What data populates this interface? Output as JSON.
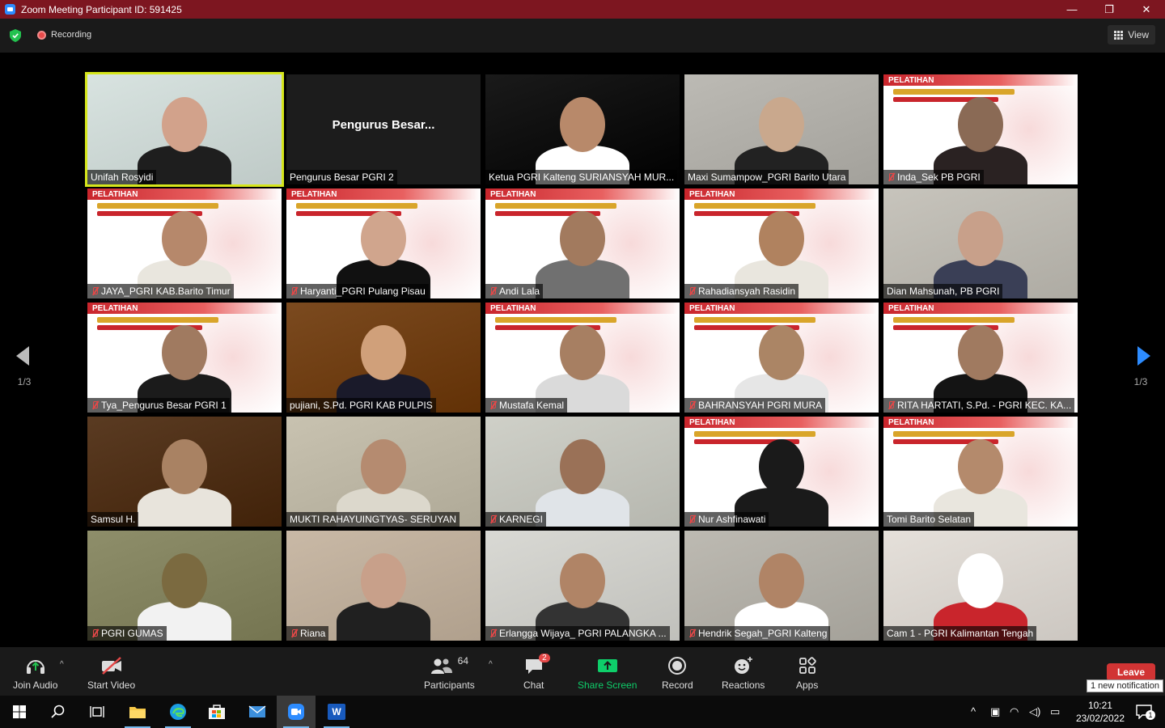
{
  "titlebar": {
    "title": "Zoom Meeting Participant ID: 591425",
    "minimize": "—",
    "maximize": "❐",
    "close": "✕"
  },
  "topbar": {
    "recording": "Recording",
    "view": "View"
  },
  "participants": [
    {
      "name": "Unifah Rosyidi",
      "muted": false,
      "style": "video",
      "colors": [
        "#d8e3e0",
        "#1e1e1e",
        "#d2a28b"
      ]
    },
    {
      "name": "Pengurus Besar PGRI 2",
      "muted": false,
      "style": "name",
      "display": "Pengurus  Besar..."
    },
    {
      "name": "Ketua PGRI Kalteng SURIANSYAH MUR...",
      "muted": false,
      "style": "video",
      "colors": [
        "#1a1a1a",
        "#ffffff",
        "#b8896a"
      ]
    },
    {
      "name": "Maxi Sumampow_PGRI Barito Utara",
      "muted": false,
      "style": "video",
      "colors": [
        "#bcbab4",
        "#222222",
        "#c9a88d"
      ]
    },
    {
      "name": "Inda_Sek PB PGRI",
      "muted": true,
      "style": "banner",
      "colors": [
        "#ffffff",
        "#2a2222",
        "#8a6a55"
      ]
    },
    {
      "name": "JAYA_PGRI KAB.Barito Timur",
      "muted": true,
      "style": "banner",
      "colors": [
        "#ffffff",
        "#e9e6de",
        "#b6886b"
      ]
    },
    {
      "name": "Haryanti_PGRI Pulang Pisau",
      "muted": true,
      "style": "banner",
      "colors": [
        "#ffffff",
        "#111111",
        "#d0a58d"
      ]
    },
    {
      "name": "Andi Lala",
      "muted": true,
      "style": "banner",
      "colors": [
        "#ffffff",
        "#707070",
        "#a27a5e"
      ]
    },
    {
      "name": "Rahadiansyah Rasidin",
      "muted": true,
      "style": "banner",
      "colors": [
        "#ffffff",
        "#e9e6de",
        "#b0825f"
      ]
    },
    {
      "name": "Dian Mahsunah, PB PGRI",
      "muted": false,
      "style": "video",
      "colors": [
        "#c7c4bc",
        "#3a3f56",
        "#c8a08a"
      ]
    },
    {
      "name": "Tya_Pengurus Besar PGRI 1",
      "muted": true,
      "style": "banner",
      "colors": [
        "#ffffff",
        "#1b1b1b",
        "#a07a60"
      ]
    },
    {
      "name": "pujiani, S.Pd. PGRI KAB PULPIS",
      "muted": false,
      "style": "video",
      "colors": [
        "#7b4a1f",
        "#1a1a2a",
        "#d0a07a"
      ]
    },
    {
      "name": "Mustafa Kemal",
      "muted": true,
      "style": "banner",
      "colors": [
        "#ffffff",
        "#dadada",
        "#a77f62"
      ]
    },
    {
      "name": "BAHRANSYAH PGRI MURA",
      "muted": true,
      "style": "banner",
      "colors": [
        "#ffffff",
        "#e6e6e6",
        "#ab8565"
      ]
    },
    {
      "name": "RITA HARTATI, S.Pd. - PGRI KEC. KA...",
      "muted": true,
      "style": "banner",
      "colors": [
        "#ffffff",
        "#141414",
        "#a07a60"
      ]
    },
    {
      "name": "Samsul H.",
      "muted": false,
      "style": "video",
      "colors": [
        "#5a3b22",
        "#e8e4dc",
        "#a98263"
      ]
    },
    {
      "name": "MUKTI RAHAYUINGTYAS- SERUYAN",
      "muted": false,
      "style": "video",
      "colors": [
        "#c8c2b0",
        "#dcd8cc",
        "#b58b70"
      ]
    },
    {
      "name": "KARNEGI",
      "muted": true,
      "style": "video",
      "colors": [
        "#cfd0c8",
        "#e0e4e8",
        "#9a7157"
      ]
    },
    {
      "name": "Nur Ashfinawati",
      "muted": true,
      "style": "banner",
      "colors": [
        "#ffffff",
        "#1a1a1a",
        "#1a1a1a"
      ]
    },
    {
      "name": "Tomi Barito Selatan",
      "muted": false,
      "style": "banner",
      "colors": [
        "#ffffff",
        "#e9e6de",
        "#b48a6c"
      ]
    },
    {
      "name": "PGRI GUMAS",
      "muted": true,
      "style": "video",
      "colors": [
        "#8e8e6a",
        "#f2f2f2",
        "#7b6a40"
      ]
    },
    {
      "name": "Riana",
      "muted": true,
      "style": "video",
      "colors": [
        "#c9b9a6",
        "#202020",
        "#c8a08a"
      ]
    },
    {
      "name": "Erlangga Wijaya_ PGRI PALANGKA ...",
      "muted": true,
      "style": "video",
      "colors": [
        "#d9d9d4",
        "#333333",
        "#b08466"
      ]
    },
    {
      "name": "Hendrik Segah_PGRI Kalteng",
      "muted": true,
      "style": "video",
      "colors": [
        "#bdbab2",
        "#ffffff",
        "#b08466"
      ]
    },
    {
      "name": "Cam 1 - PGRI Kalimantan Tengah",
      "muted": false,
      "style": "video",
      "colors": [
        "#e5e0da",
        "#c9252c",
        "#ffffff"
      ]
    }
  ],
  "pagination": {
    "left": "1/3",
    "right": "1/3"
  },
  "toolbar": {
    "join_audio": "Join Audio",
    "start_video": "Start Video",
    "participants": "Participants",
    "participants_count": "64",
    "chat": "Chat",
    "chat_badge": "2",
    "share_screen": "Share Screen",
    "record": "Record",
    "reactions": "Reactions",
    "apps": "Apps",
    "leave": "Leave",
    "notification": "1 new notification"
  },
  "taskbar": {
    "time": "10:21",
    "date": "23/02/2022",
    "notif_count": "1",
    "word_label": "W"
  },
  "colors": {
    "titlebar": "#7d1620",
    "share_green": "#0ecf6a",
    "leave_red": "#d13434",
    "active_speaker": "#d6e61b",
    "arrow_blue": "#2d8cff"
  }
}
